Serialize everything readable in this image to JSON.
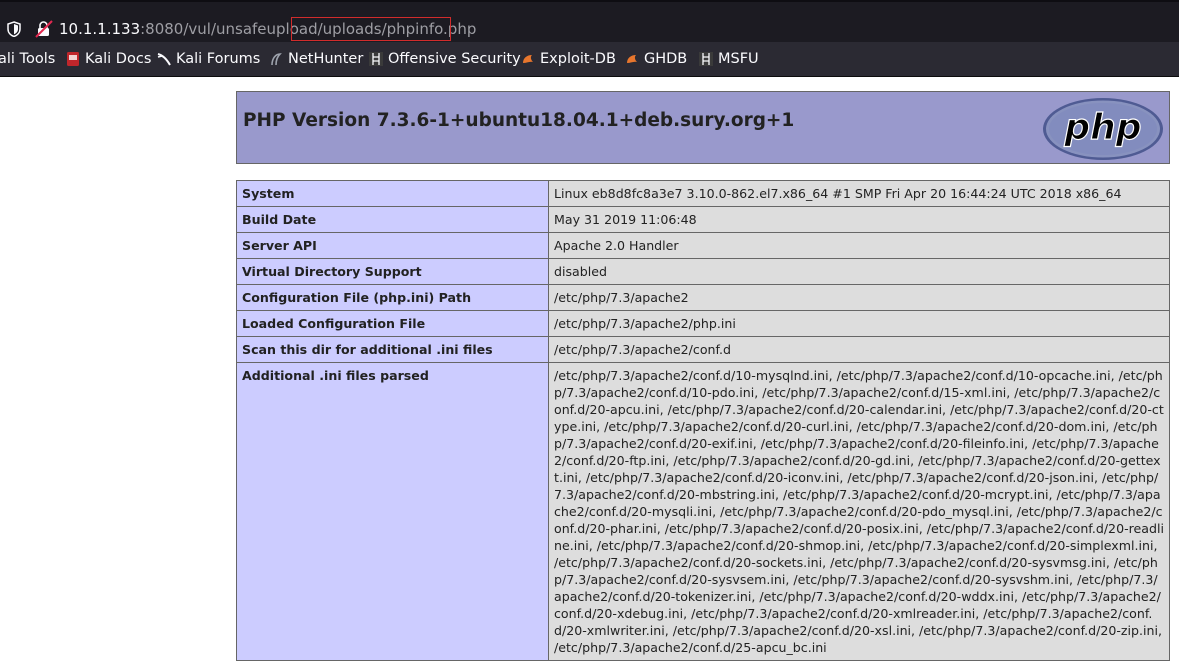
{
  "browser": {
    "url_host": "10.1.1.133",
    "url_rest": ":8080/vul/unsafeupload/uploads/phpinfo.php",
    "bookmarks": [
      {
        "label": "ali Tools",
        "icon": "kali-tools-icon"
      },
      {
        "label": "Kali Docs",
        "icon": "kali-docs-icon"
      },
      {
        "label": "Kali Forums",
        "icon": "kali-forums-icon"
      },
      {
        "label": "NetHunter",
        "icon": "nethunter-icon"
      },
      {
        "label": "Offensive Security",
        "icon": "offensive-security-icon"
      },
      {
        "label": "Exploit-DB",
        "icon": "exploit-db-icon"
      },
      {
        "label": "GHDB",
        "icon": "ghdb-icon"
      },
      {
        "label": "MSFU",
        "icon": "msfu-icon"
      }
    ],
    "highlight_color": "#d12c2c"
  },
  "page": {
    "title": "PHP Version 7.3.6-1+ubuntu18.04.1+deb.sury.org+1",
    "logo_text": "php",
    "rows": [
      {
        "key": "System",
        "value": "Linux eb8d8fc8a3e7 3.10.0-862.el7.x86_64 #1 SMP Fri Apr 20 16:44:24 UTC 2018 x86_64"
      },
      {
        "key": "Build Date",
        "value": "May 31 2019 11:06:48"
      },
      {
        "key": "Server API",
        "value": "Apache 2.0 Handler"
      },
      {
        "key": "Virtual Directory Support",
        "value": "disabled"
      },
      {
        "key": "Configuration File (php.ini) Path",
        "value": "/etc/php/7.3/apache2"
      },
      {
        "key": "Loaded Configuration File",
        "value": "/etc/php/7.3/apache2/php.ini"
      },
      {
        "key": "Scan this dir for additional .ini files",
        "value": "/etc/php/7.3/apache2/conf.d"
      },
      {
        "key": "Additional .ini files parsed",
        "value": "/etc/php/7.3/apache2/conf.d/10-mysqlnd.ini, /etc/php/7.3/apache2/conf.d/10-opcache.ini, /etc/php/7.3/apache2/conf.d/10-pdo.ini, /etc/php/7.3/apache2/conf.d/15-xml.ini, /etc/php/7.3/apache2/conf.d/20-apcu.ini, /etc/php/7.3/apache2/conf.d/20-calendar.ini, /etc/php/7.3/apache2/conf.d/20-ctype.ini, /etc/php/7.3/apache2/conf.d/20-curl.ini, /etc/php/7.3/apache2/conf.d/20-dom.ini, /etc/php/7.3/apache2/conf.d/20-exif.ini, /etc/php/7.3/apache2/conf.d/20-fileinfo.ini, /etc/php/7.3/apache2/conf.d/20-ftp.ini, /etc/php/7.3/apache2/conf.d/20-gd.ini, /etc/php/7.3/apache2/conf.d/20-gettext.ini, /etc/php/7.3/apache2/conf.d/20-iconv.ini, /etc/php/7.3/apache2/conf.d/20-json.ini, /etc/php/7.3/apache2/conf.d/20-mbstring.ini, /etc/php/7.3/apache2/conf.d/20-mcrypt.ini, /etc/php/7.3/apache2/conf.d/20-mysqli.ini, /etc/php/7.3/apache2/conf.d/20-pdo_mysql.ini, /etc/php/7.3/apache2/conf.d/20-phar.ini, /etc/php/7.3/apache2/conf.d/20-posix.ini, /etc/php/7.3/apache2/conf.d/20-readline.ini, /etc/php/7.3/apache2/conf.d/20-shmop.ini, /etc/php/7.3/apache2/conf.d/20-simplexml.ini, /etc/php/7.3/apache2/conf.d/20-sockets.ini, /etc/php/7.3/apache2/conf.d/20-sysvmsg.ini, /etc/php/7.3/apache2/conf.d/20-sysvsem.ini, /etc/php/7.3/apache2/conf.d/20-sysvshm.ini, /etc/php/7.3/apache2/conf.d/20-tokenizer.ini, /etc/php/7.3/apache2/conf.d/20-wddx.ini, /etc/php/7.3/apache2/conf.d/20-xdebug.ini, /etc/php/7.3/apache2/conf.d/20-xmlreader.ini, /etc/php/7.3/apache2/conf.d/20-xmlwriter.ini, /etc/php/7.3/apache2/conf.d/20-xsl.ini, /etc/php/7.3/apache2/conf.d/20-zip.ini, /etc/php/7.3/apache2/conf.d/25-apcu_bc.ini"
      }
    ],
    "colors": {
      "header_bg": "#9999cc",
      "key_bg": "#ccccff",
      "value_bg": "#dddddd"
    }
  }
}
